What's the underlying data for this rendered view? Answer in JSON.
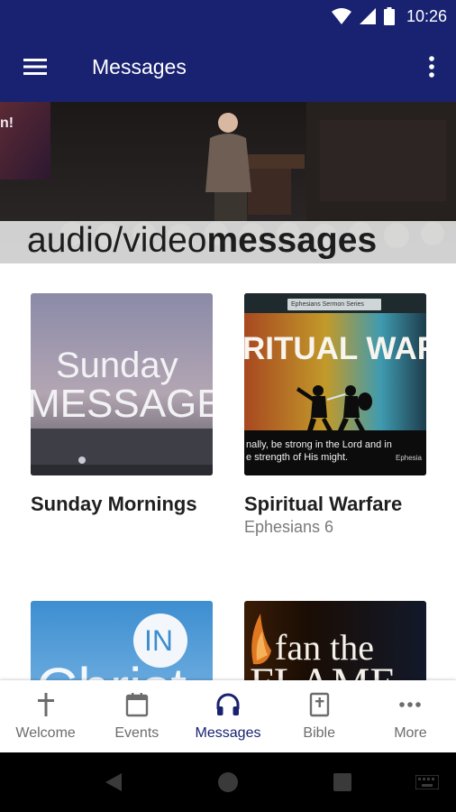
{
  "status_bar": {
    "time": "10:26"
  },
  "app_bar": {
    "title": "Messages"
  },
  "hero": {
    "caption_part1": "audio/video",
    "caption_part2": "messages",
    "banner_fragment": "n!"
  },
  "cards": [
    {
      "title": "Sunday Mornings",
      "subtitle": "",
      "thumb_line1": "Sunday",
      "thumb_line2": "MESSAGES"
    },
    {
      "title": "Spiritual Warfare",
      "subtitle": "Ephesians 6",
      "thumb_series": "Ephesians Sermon Series",
      "thumb_heading": "RITUAL WARFA",
      "thumb_verse1": "nally, be strong in the Lord and in",
      "thumb_verse2": "e strength of His might.",
      "thumb_ref": "Ephesia"
    },
    {
      "thumb_badge": "IN",
      "thumb_word": "Christ"
    },
    {
      "thumb_line1": "fan the",
      "thumb_line2": "FLAME"
    }
  ],
  "bottom_nav": {
    "items": [
      {
        "label": "Welcome",
        "icon": "cross-icon"
      },
      {
        "label": "Events",
        "icon": "calendar-icon"
      },
      {
        "label": "Messages",
        "icon": "headphones-icon"
      },
      {
        "label": "Bible",
        "icon": "bible-icon"
      },
      {
        "label": "More",
        "icon": "more-dots-icon"
      }
    ],
    "active_index": 2
  },
  "colors": {
    "primary": "#182270",
    "active_tab": "#182270",
    "inactive_tab": "#6c6c6c"
  }
}
